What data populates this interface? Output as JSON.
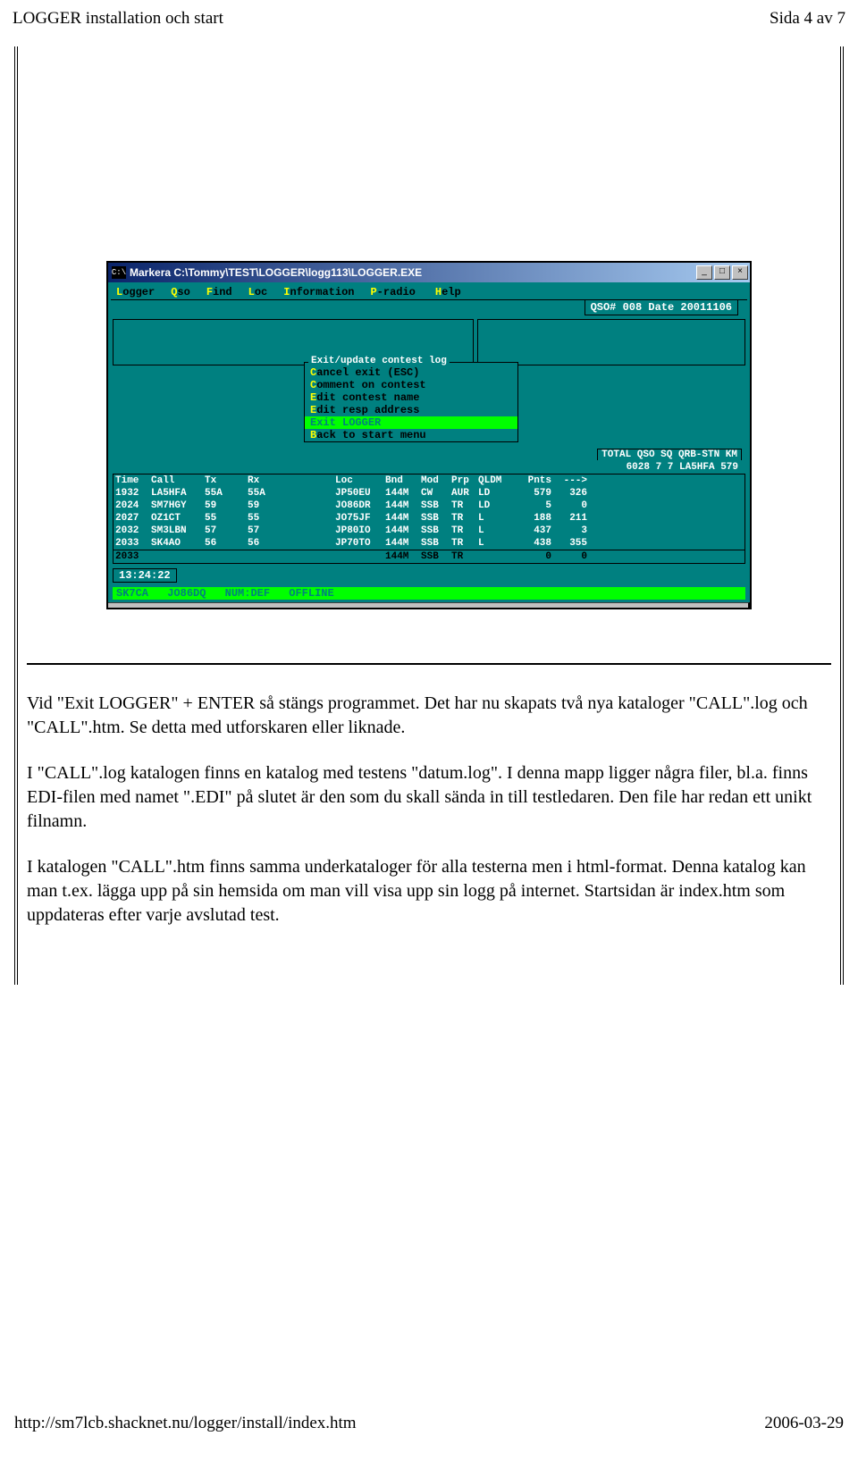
{
  "header": {
    "left": "LOGGER installation och start",
    "right": "Sida 4 av 7"
  },
  "window": {
    "title": "Markera C:\\Tommy\\TEST\\LOGGER\\logg113\\LOGGER.EXE",
    "title_icon": "C:\\",
    "btn_min": "_",
    "btn_max": "□",
    "btn_close": "×",
    "menu": [
      {
        "hl": "L",
        "rest": "ogger"
      },
      {
        "hl": "Q",
        "rest": "so"
      },
      {
        "hl": "F",
        "rest": "ind"
      },
      {
        "hl": "L",
        "rest": "oc"
      },
      {
        "hl": "I",
        "rest": "nformation"
      },
      {
        "hl": "P",
        "rest": "-radio"
      },
      {
        "hl": "H",
        "rest": "elp"
      }
    ],
    "qso_line": "QSO# 008   Date 20011106",
    "dialog_title": "Exit/update contest log",
    "dialog_items": [
      {
        "hl": "C",
        "rest": "ancel exit (ESC)",
        "sel": false
      },
      {
        "hl": "C",
        "rest": "omment on contest",
        "sel": false
      },
      {
        "hl": "E",
        "rest": "dit contest name",
        "sel": false
      },
      {
        "hl": "E",
        "rest": "dit resp address",
        "sel": false
      },
      {
        "hl": "E",
        "rest": "xit LOGGER",
        "sel": true
      },
      {
        "hl": "B",
        "rest": "ack to start menu",
        "sel": false
      }
    ],
    "stats_hdr": "TOTAL QSO   SQ QRB-STN   KM",
    "stats_val": "6028   7    7 LA5HFA  579",
    "cols": {
      "time": "Time",
      "call": "Call",
      "tx": "Tx",
      "rx": "Rx",
      "loc": "Loc",
      "bnd": "Bnd",
      "mod": "Mod",
      "prp": "Prp",
      "qldm": "QLDM",
      "pnts": "Pnts",
      "arrow": "--->"
    },
    "rows": [
      {
        "time": "1932",
        "call": "LA5HFA",
        "tx": "55A",
        "rx": "55A",
        "loc": "JP50EU",
        "bnd": "144M",
        "mod": "CW",
        "prp": "AUR",
        "qldm": "LD",
        "pnts": "579",
        "last": "326"
      },
      {
        "time": "2024",
        "call": "SM7HGY",
        "tx": "59",
        "rx": "59",
        "loc": "JO86DR",
        "bnd": "144M",
        "mod": "SSB",
        "prp": "TR",
        "qldm": "LD",
        "pnts": "5",
        "last": "0"
      },
      {
        "time": "2027",
        "call": "OZ1CT",
        "tx": "55",
        "rx": "55",
        "loc": "JO75JF",
        "bnd": "144M",
        "mod": "SSB",
        "prp": "TR",
        "qldm": "L",
        "pnts": "188",
        "last": "211"
      },
      {
        "time": "2032",
        "call": "SM3LBN",
        "tx": "57",
        "rx": "57",
        "loc": "JP80IO",
        "bnd": "144M",
        "mod": "SSB",
        "prp": "TR",
        "qldm": "L",
        "pnts": "437",
        "last": "3"
      },
      {
        "time": "2033",
        "call": "SK4AO",
        "tx": "56",
        "rx": "56",
        "loc": "JP70TO",
        "bnd": "144M",
        "mod": "SSB",
        "prp": "TR",
        "qldm": "L",
        "pnts": "438",
        "last": "355"
      }
    ],
    "inputrow": {
      "time": "2033",
      "call": "",
      "tx": "",
      "rx": "",
      "loc": "",
      "bnd": "144M",
      "mod": "SSB",
      "prp": "TR",
      "qldm": "",
      "pnts": "0",
      "last": "0"
    },
    "clock": "13:24:22",
    "status": {
      "a": "SK7CA",
      "b": "JO86DQ",
      "c": "NUM:DEF",
      "d": "OFFLINE"
    }
  },
  "paras": {
    "p1": "Vid \"Exit LOGGER\" + ENTER så stängs programmet. Det har nu skapats två nya kataloger \"CALL\".log och \"CALL\".htm. Se detta med utforskaren eller liknade.",
    "p2": "I \"CALL\".log katalogen finns en katalog med testens \"datum.log\". I denna mapp ligger några filer, bl.a. finns EDI-filen med namet \".EDI\" på slutet är den som du skall sända in till testledaren. Den file har redan ett unikt filnamn.",
    "p3": "I katalogen \"CALL\".htm finns samma underkataloger för alla testerna men i html-format. Denna katalog kan man t.ex. lägga upp på sin hemsida om man vill visa upp sin logg på internet. Startsidan är index.htm som uppdateras efter varje avslutad test."
  },
  "footer": {
    "left": "http://sm7lcb.shacknet.nu/logger/install/index.htm",
    "right": "2006-03-29"
  }
}
